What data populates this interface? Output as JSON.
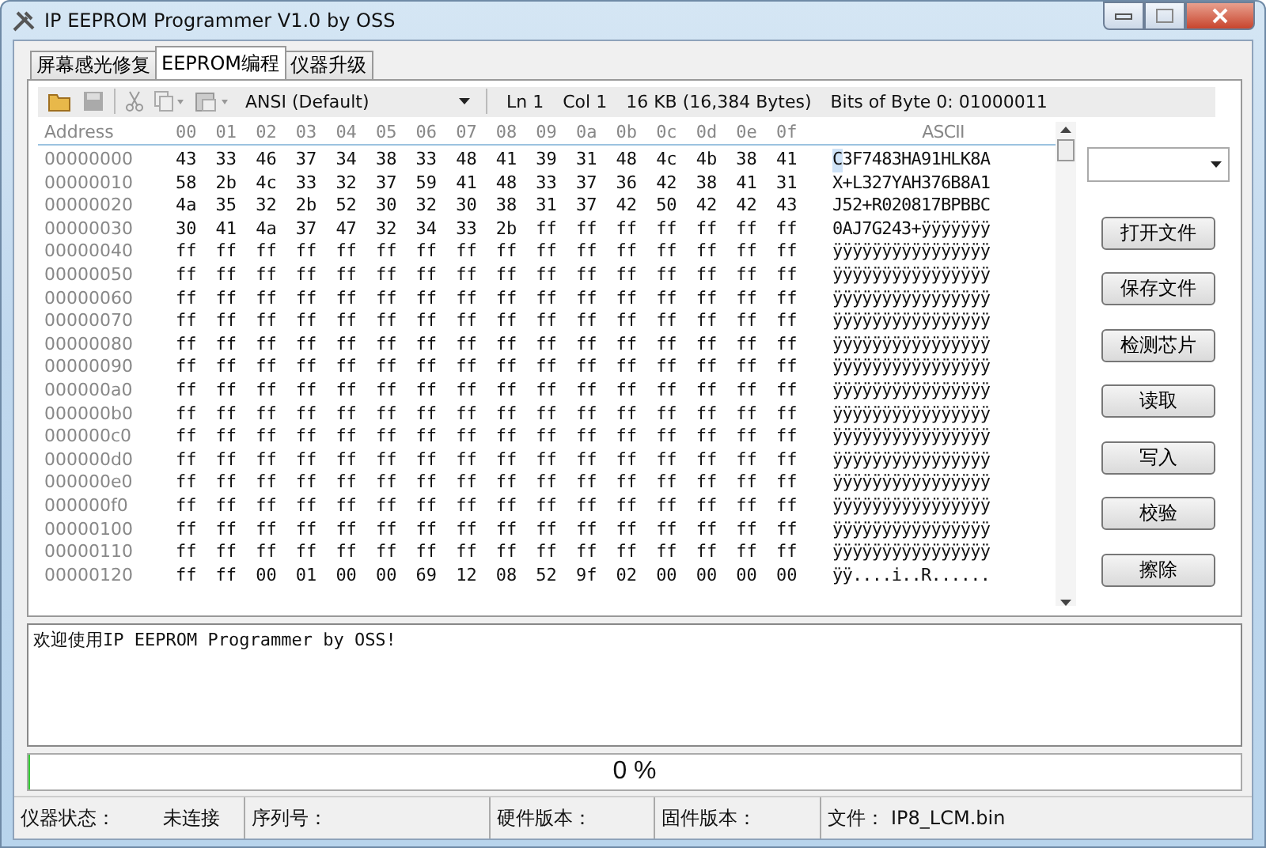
{
  "window": {
    "title": "IP EEPROM Programmer V1.0 by OSS"
  },
  "tabs": [
    {
      "label": "屏幕感光修复",
      "selected": false
    },
    {
      "label": "EEPROM编程",
      "selected": true
    },
    {
      "label": "仪器升级",
      "selected": false
    }
  ],
  "toolbar": {
    "encoding": "ANSI (Default)",
    "line": "Ln 1",
    "column": "Col 1",
    "size": "16 KB (16,384 Bytes)",
    "bits": "Bits of Byte 0: 01000011"
  },
  "hex_view": {
    "address_header": "Address",
    "offset_headers": [
      "00",
      "01",
      "02",
      "03",
      "04",
      "05",
      "06",
      "07",
      "08",
      "09",
      "0a",
      "0b",
      "0c",
      "0d",
      "0e",
      "0f"
    ],
    "ascii_header": "ASCII",
    "rows": [
      {
        "address": "00000000",
        "bytes": [
          "43",
          "33",
          "46",
          "37",
          "34",
          "38",
          "33",
          "48",
          "41",
          "39",
          "31",
          "48",
          "4c",
          "4b",
          "38",
          "41"
        ],
        "ascii": "C3F7483HA91HLK8A",
        "caret": true
      },
      {
        "address": "00000010",
        "bytes": [
          "58",
          "2b",
          "4c",
          "33",
          "32",
          "37",
          "59",
          "41",
          "48",
          "33",
          "37",
          "36",
          "42",
          "38",
          "41",
          "31"
        ],
        "ascii": "X+L327YAH376B8A1",
        "caret": false
      },
      {
        "address": "00000020",
        "bytes": [
          "4a",
          "35",
          "32",
          "2b",
          "52",
          "30",
          "32",
          "30",
          "38",
          "31",
          "37",
          "42",
          "50",
          "42",
          "42",
          "43"
        ],
        "ascii": "J52+R020817BPBBC",
        "caret": false
      },
      {
        "address": "00000030",
        "bytes": [
          "30",
          "41",
          "4a",
          "37",
          "47",
          "32",
          "34",
          "33",
          "2b",
          "ff",
          "ff",
          "ff",
          "ff",
          "ff",
          "ff",
          "ff"
        ],
        "ascii": "0AJ7G243+ÿÿÿÿÿÿÿ",
        "caret": false
      },
      {
        "address": "00000040",
        "bytes": [
          "ff",
          "ff",
          "ff",
          "ff",
          "ff",
          "ff",
          "ff",
          "ff",
          "ff",
          "ff",
          "ff",
          "ff",
          "ff",
          "ff",
          "ff",
          "ff"
        ],
        "ascii": "ÿÿÿÿÿÿÿÿÿÿÿÿÿÿÿÿ",
        "caret": false
      },
      {
        "address": "00000050",
        "bytes": [
          "ff",
          "ff",
          "ff",
          "ff",
          "ff",
          "ff",
          "ff",
          "ff",
          "ff",
          "ff",
          "ff",
          "ff",
          "ff",
          "ff",
          "ff",
          "ff"
        ],
        "ascii": "ÿÿÿÿÿÿÿÿÿÿÿÿÿÿÿÿ",
        "caret": false
      },
      {
        "address": "00000060",
        "bytes": [
          "ff",
          "ff",
          "ff",
          "ff",
          "ff",
          "ff",
          "ff",
          "ff",
          "ff",
          "ff",
          "ff",
          "ff",
          "ff",
          "ff",
          "ff",
          "ff"
        ],
        "ascii": "ÿÿÿÿÿÿÿÿÿÿÿÿÿÿÿÿ",
        "caret": false
      },
      {
        "address": "00000070",
        "bytes": [
          "ff",
          "ff",
          "ff",
          "ff",
          "ff",
          "ff",
          "ff",
          "ff",
          "ff",
          "ff",
          "ff",
          "ff",
          "ff",
          "ff",
          "ff",
          "ff"
        ],
        "ascii": "ÿÿÿÿÿÿÿÿÿÿÿÿÿÿÿÿ",
        "caret": false
      },
      {
        "address": "00000080",
        "bytes": [
          "ff",
          "ff",
          "ff",
          "ff",
          "ff",
          "ff",
          "ff",
          "ff",
          "ff",
          "ff",
          "ff",
          "ff",
          "ff",
          "ff",
          "ff",
          "ff"
        ],
        "ascii": "ÿÿÿÿÿÿÿÿÿÿÿÿÿÿÿÿ",
        "caret": false
      },
      {
        "address": "00000090",
        "bytes": [
          "ff",
          "ff",
          "ff",
          "ff",
          "ff",
          "ff",
          "ff",
          "ff",
          "ff",
          "ff",
          "ff",
          "ff",
          "ff",
          "ff",
          "ff",
          "ff"
        ],
        "ascii": "ÿÿÿÿÿÿÿÿÿÿÿÿÿÿÿÿ",
        "caret": false
      },
      {
        "address": "000000a0",
        "bytes": [
          "ff",
          "ff",
          "ff",
          "ff",
          "ff",
          "ff",
          "ff",
          "ff",
          "ff",
          "ff",
          "ff",
          "ff",
          "ff",
          "ff",
          "ff",
          "ff"
        ],
        "ascii": "ÿÿÿÿÿÿÿÿÿÿÿÿÿÿÿÿ",
        "caret": false
      },
      {
        "address": "000000b0",
        "bytes": [
          "ff",
          "ff",
          "ff",
          "ff",
          "ff",
          "ff",
          "ff",
          "ff",
          "ff",
          "ff",
          "ff",
          "ff",
          "ff",
          "ff",
          "ff",
          "ff"
        ],
        "ascii": "ÿÿÿÿÿÿÿÿÿÿÿÿÿÿÿÿ",
        "caret": false
      },
      {
        "address": "000000c0",
        "bytes": [
          "ff",
          "ff",
          "ff",
          "ff",
          "ff",
          "ff",
          "ff",
          "ff",
          "ff",
          "ff",
          "ff",
          "ff",
          "ff",
          "ff",
          "ff",
          "ff"
        ],
        "ascii": "ÿÿÿÿÿÿÿÿÿÿÿÿÿÿÿÿ",
        "caret": false
      },
      {
        "address": "000000d0",
        "bytes": [
          "ff",
          "ff",
          "ff",
          "ff",
          "ff",
          "ff",
          "ff",
          "ff",
          "ff",
          "ff",
          "ff",
          "ff",
          "ff",
          "ff",
          "ff",
          "ff"
        ],
        "ascii": "ÿÿÿÿÿÿÿÿÿÿÿÿÿÿÿÿ",
        "caret": false
      },
      {
        "address": "000000e0",
        "bytes": [
          "ff",
          "ff",
          "ff",
          "ff",
          "ff",
          "ff",
          "ff",
          "ff",
          "ff",
          "ff",
          "ff",
          "ff",
          "ff",
          "ff",
          "ff",
          "ff"
        ],
        "ascii": "ÿÿÿÿÿÿÿÿÿÿÿÿÿÿÿÿ",
        "caret": false
      },
      {
        "address": "000000f0",
        "bytes": [
          "ff",
          "ff",
          "ff",
          "ff",
          "ff",
          "ff",
          "ff",
          "ff",
          "ff",
          "ff",
          "ff",
          "ff",
          "ff",
          "ff",
          "ff",
          "ff"
        ],
        "ascii": "ÿÿÿÿÿÿÿÿÿÿÿÿÿÿÿÿ",
        "caret": false
      },
      {
        "address": "00000100",
        "bytes": [
          "ff",
          "ff",
          "ff",
          "ff",
          "ff",
          "ff",
          "ff",
          "ff",
          "ff",
          "ff",
          "ff",
          "ff",
          "ff",
          "ff",
          "ff",
          "ff"
        ],
        "ascii": "ÿÿÿÿÿÿÿÿÿÿÿÿÿÿÿÿ",
        "caret": false
      },
      {
        "address": "00000110",
        "bytes": [
          "ff",
          "ff",
          "ff",
          "ff",
          "ff",
          "ff",
          "ff",
          "ff",
          "ff",
          "ff",
          "ff",
          "ff",
          "ff",
          "ff",
          "ff",
          "ff"
        ],
        "ascii": "ÿÿÿÿÿÿÿÿÿÿÿÿÿÿÿÿ",
        "caret": false
      },
      {
        "address": "00000120",
        "bytes": [
          "ff",
          "ff",
          "00",
          "01",
          "00",
          "00",
          "69",
          "12",
          "08",
          "52",
          "9f",
          "02",
          "00",
          "00",
          "00",
          "00"
        ],
        "ascii": "ÿÿ....i..R......",
        "caret": false
      }
    ]
  },
  "actions": [
    "打开文件",
    "保存文件",
    "检测芯片",
    "读取",
    "写入",
    "校验",
    "擦除"
  ],
  "log": "欢迎使用IP EEPROM Programmer by OSS!",
  "progress": {
    "level": 0,
    "reading": "0 %"
  },
  "status_bar": [
    {
      "label": "仪器状态：",
      "value": "未连接"
    },
    {
      "label": "序列号："
    },
    {
      "label": "硬件版本："
    },
    {
      "label": "固件版本："
    },
    {
      "label": "文件：",
      "value": "IP8_LCM.bin"
    }
  ]
}
